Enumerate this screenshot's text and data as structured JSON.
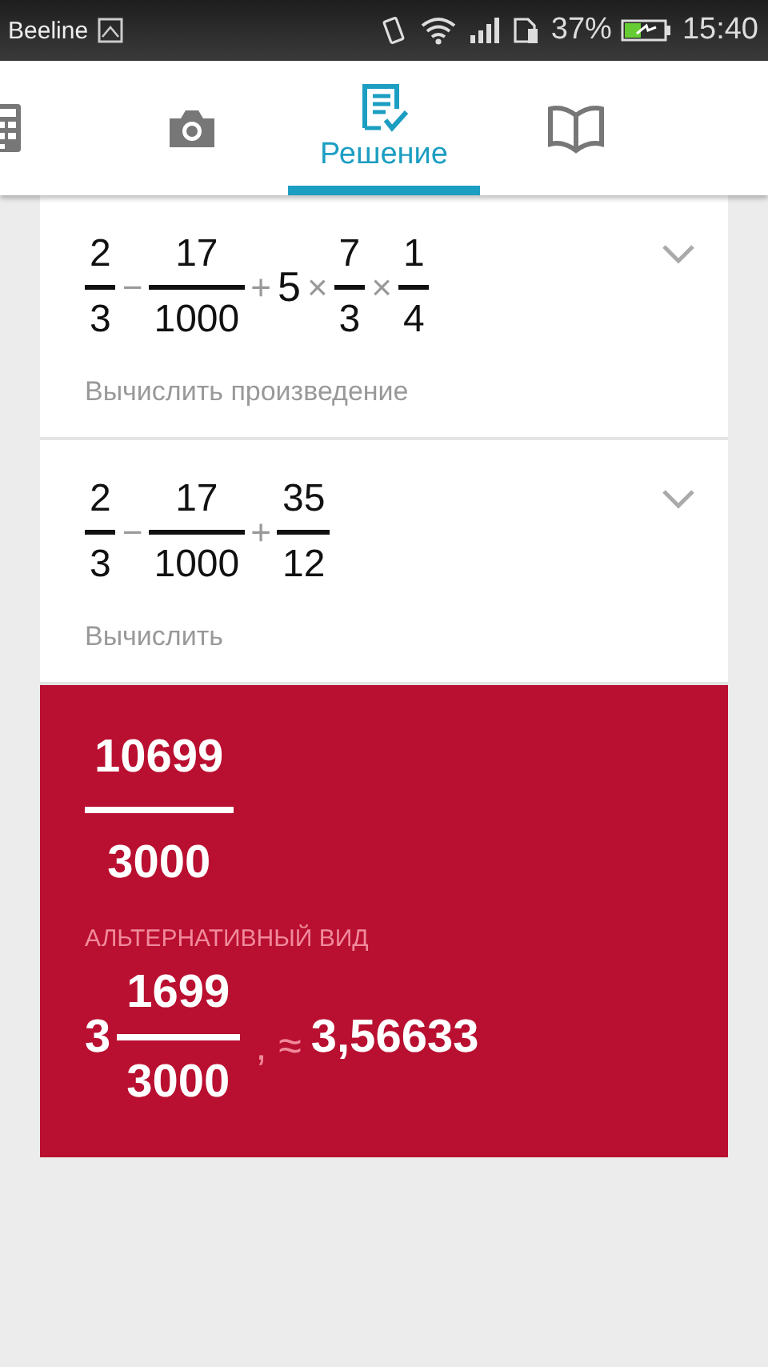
{
  "status_bar": {
    "carrier": "Beeline",
    "battery": "37%",
    "time": "15:40"
  },
  "tabs": [
    {
      "kind": "calculator",
      "selected": false
    },
    {
      "kind": "camera",
      "selected": false
    },
    {
      "kind": "solution",
      "label": "Решение",
      "selected": true
    },
    {
      "kind": "book",
      "selected": false
    }
  ],
  "steps": [
    {
      "expression": [
        {
          "kind": "frac",
          "num": "2",
          "den": "3"
        },
        {
          "kind": "op",
          "text": "−"
        },
        {
          "kind": "frac",
          "num": "17",
          "den": "1000"
        },
        {
          "kind": "op",
          "text": "+"
        },
        {
          "kind": "num",
          "text": "5"
        },
        {
          "kind": "op",
          "text": "×"
        },
        {
          "kind": "frac",
          "num": "7",
          "den": "3"
        },
        {
          "kind": "op",
          "text": "×"
        },
        {
          "kind": "frac",
          "num": "1",
          "den": "4"
        }
      ],
      "caption": "Вычислить произведение"
    },
    {
      "expression": [
        {
          "kind": "frac",
          "num": "2",
          "den": "3"
        },
        {
          "kind": "op",
          "text": "−"
        },
        {
          "kind": "frac",
          "num": "17",
          "den": "1000"
        },
        {
          "kind": "op",
          "text": "+"
        },
        {
          "kind": "frac",
          "num": "35",
          "den": "12"
        }
      ],
      "caption": "Вычислить"
    }
  ],
  "result": {
    "num": "10699",
    "den": "3000",
    "alt_label": "АЛЬТЕРНАТИВНЫЙ ВИД",
    "alt_whole": "3",
    "alt_num": "1699",
    "alt_den": "3000",
    "approx_sign": ", ≈",
    "approx_value": "3,56633"
  }
}
